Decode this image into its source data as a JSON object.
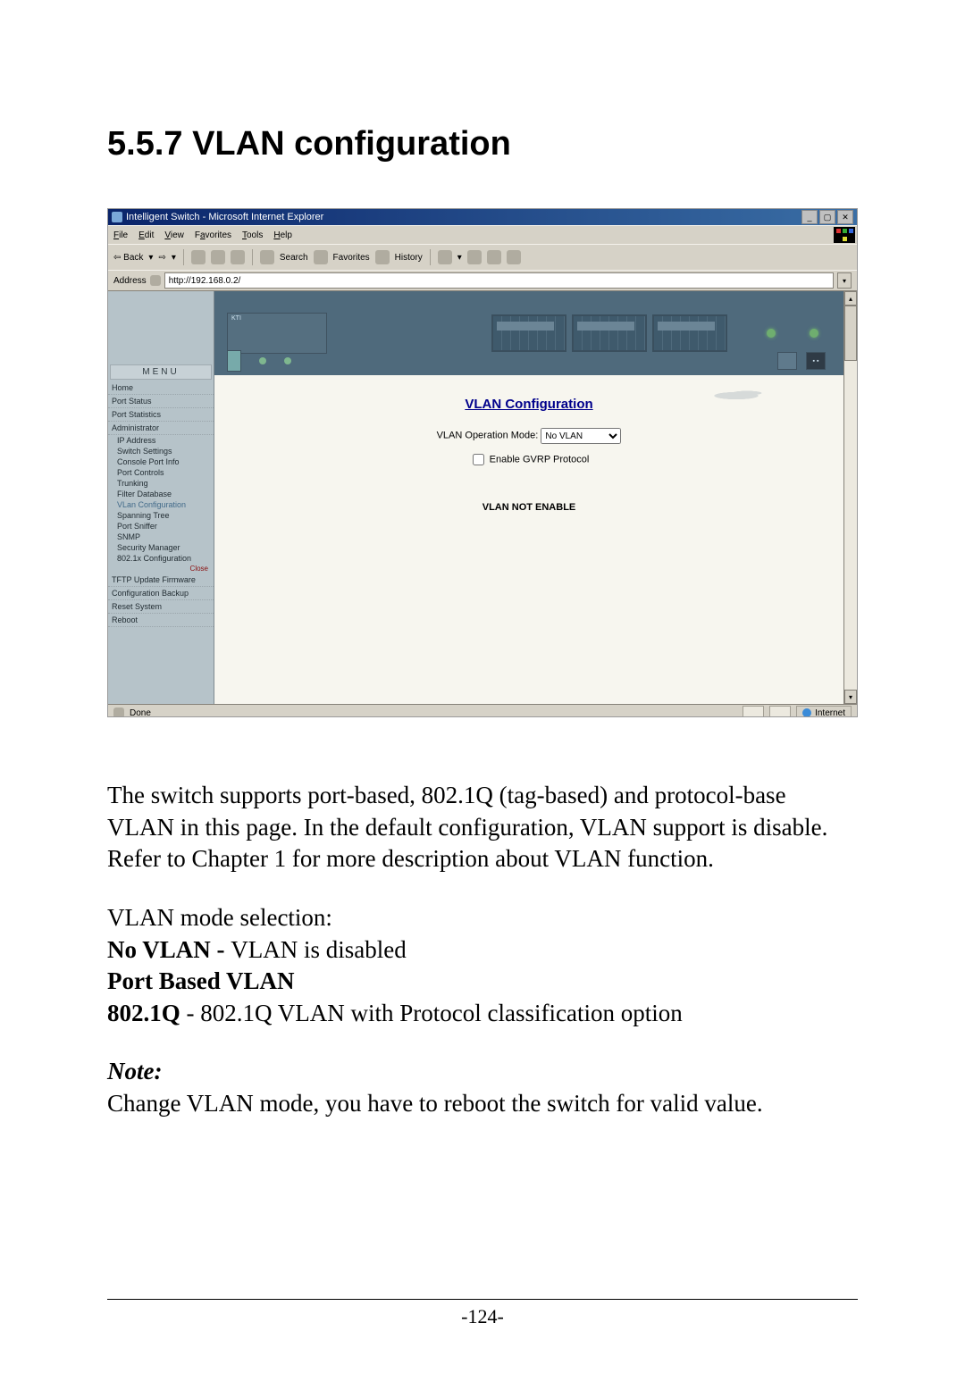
{
  "heading": "5.5.7 VLAN configuration",
  "screenshot": {
    "titlebar": "Intelligent Switch - Microsoft Internet Explorer",
    "menubar": [
      "File",
      "Edit",
      "View",
      "Favorites",
      "Tools",
      "Help"
    ],
    "toolbar": {
      "back": "Back",
      "search": "Search",
      "favorites": "Favorites",
      "history": "History"
    },
    "addressbar": {
      "label": "Address",
      "value": "http://192.168.0.2/"
    },
    "sidebar": {
      "menu_label": "MENU",
      "items_top": [
        "Home",
        "Port Status",
        "Port Statistics",
        "Administrator"
      ],
      "items_sub": [
        "IP Address",
        "Switch Settings",
        "Console Port Info",
        "Port Controls",
        "Trunking",
        "Filter Database",
        "VLan Configuration",
        "Spanning Tree",
        "Port Sniffer",
        "SNMP",
        "Security Manager",
        "802.1x Configuration"
      ],
      "close": "Close",
      "items_bottom": [
        "TFTP Update Firmware",
        "Configuration Backup",
        "Reset System",
        "Reboot"
      ]
    },
    "content": {
      "title": "VLAN Configuration",
      "mode_label": "VLAN Operation Mode:",
      "mode_value": "No VLAN",
      "gvrp_label": "Enable GVRP Protocol",
      "not_enable": "VLAN NOT ENABLE"
    },
    "statusbar": {
      "done": "Done",
      "zone": "Internet"
    }
  },
  "para1": "The switch supports port-based, 802.1Q (tag-based) and protocol-base VLAN in this page. In the default configuration, VLAN support is disable. Refer to Chapter 1 for more description about VLAN function.",
  "modesel_line": "VLAN mode selection:",
  "no_vlan_bold": "No VLAN - ",
  "no_vlan_rest": "VLAN is disabled",
  "port_based": "Port Based VLAN",
  "q_bold": "802.1Q",
  "q_rest": " - 802.1Q VLAN with Protocol classification option",
  "note_label": "Note:",
  "note_body": "Change VLAN mode, you have to reboot the switch for valid value.",
  "page_number": "-124-"
}
